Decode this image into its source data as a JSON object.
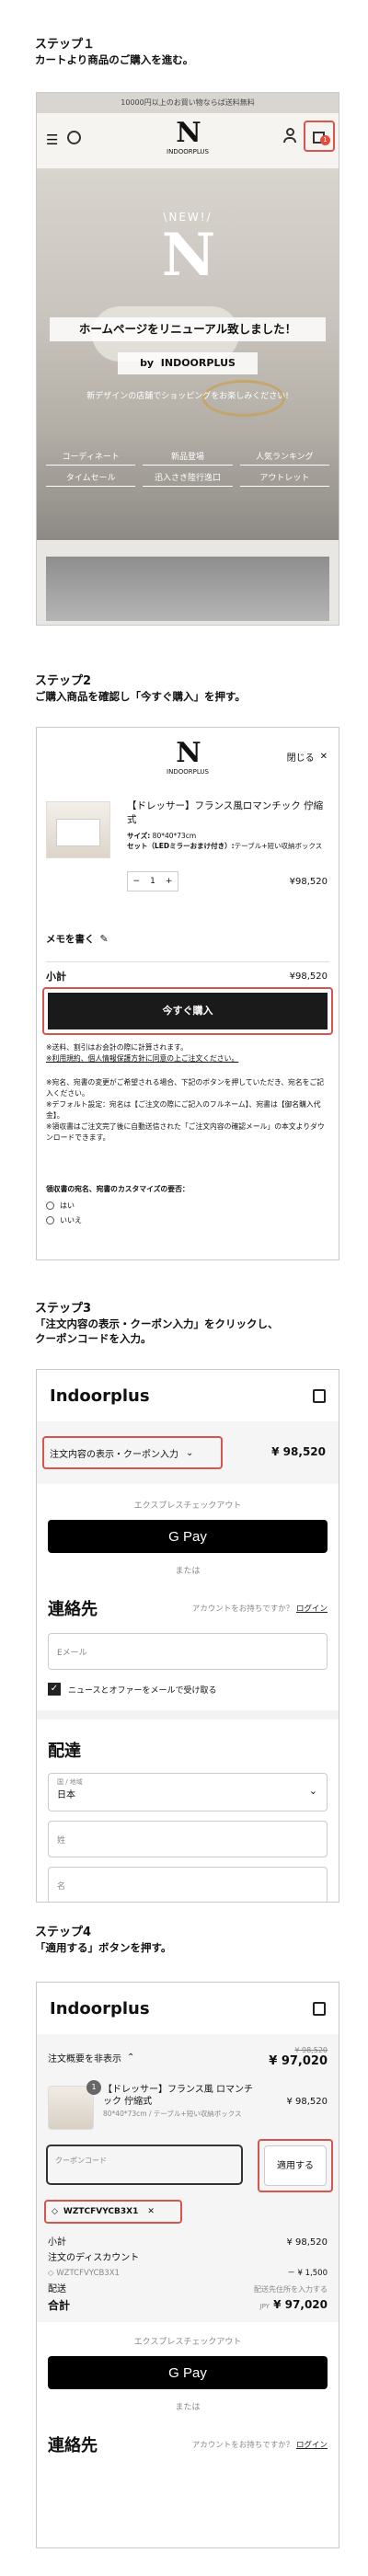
{
  "colors": {
    "accent_red": "#d9534f",
    "dark": "#1a1a1a",
    "banner_bg": "#ededed",
    "hero_overlay": "#000000",
    "badge_red": "#e54b3c"
  },
  "step1": {
    "title": "ステップ１",
    "desc": "カートより商品のご購入を進む。",
    "banner": "10000円以上のお買い物ならば送料無料",
    "brand": "INDOORPLUS",
    "cart_count": "1",
    "new_label": "\\NEW!/",
    "renewal": "ホームページをリニューアル致しました！",
    "by": "by",
    "by_brand": "INDOORPLUS",
    "new_sub": "新デザインの店舗でショッピングをお楽しみください!",
    "nav": [
      "コーディネート",
      "新品登場",
      "人気ランキング",
      "タイムセール",
      "迅入さき陸行逸口",
      "アウトレット"
    ]
  },
  "step2": {
    "title": "ステップ2",
    "desc": "ご購入商品を確認し「今すぐ購入」を押す。",
    "brand": "INDOORPLUS",
    "close": "閉じる",
    "close_x": "✕",
    "product_name": "【ドレッサー】フランス風ロマンチック 佇縮式",
    "size_label": "サイズ:",
    "size_value": "80*40*73cm",
    "set_label": "セット（LEDミラーおまけ付き）:",
    "set_value": "テーブル+短い収納ボックス",
    "qty": "1",
    "qty_minus": "−",
    "qty_plus": "+",
    "price": "¥98,520",
    "memo": "メモを書く",
    "subtotal_label": "小計",
    "subtotal": "¥98,520",
    "buy_now": "今すぐ購入",
    "notes": [
      "※送料、割引はお会計の際に計算されます。",
      "※利用規約、個人情報保護方針に同意の上ご注文ください。",
      "※宛名、宛書の変更がご希望される場合、下記のボタンを押していただき、宛名をご記入ください。",
      "※デフォルト設定：宛名は【ご注文の際にご記入のフルネーム】、宛書は【御名購入代金】。",
      "※領収書はご注文完了後に自動送信された「ご注文内容の確認メール」の本文よりダウンロードできます。"
    ],
    "custom_label": "領収書の宛名、宛書のカスタマイズの要否：",
    "opt_yes": "はい",
    "opt_no": "いいえ"
  },
  "step3": {
    "title": "ステップ3",
    "desc1": "「注文内容の表示・クーポン入力」をクリックし、",
    "desc2": "クーポンコードを入力。",
    "shop": "Indoorplus",
    "order_summary": "注文内容の表示・クーポン入力",
    "chevron": "⌄",
    "total": "¥ 98,520",
    "express": "エクスプレスチェックアウト",
    "gpay": "G Pay",
    "or": "または",
    "contact": "連絡先",
    "account_q": "アカウントをお持ちですか？",
    "login": "ログイン",
    "email_ph": "Eメール",
    "newsletter": "ニュースとオファーをメールで受け取る",
    "delivery": "配達",
    "country_label": "国 / 地域",
    "country": "日本",
    "last_name": "姓",
    "first_name": "名"
  },
  "step4": {
    "title": "ステップ4",
    "desc": "「適用する」ボタンを押す。",
    "shop": "Indoorplus",
    "order_hide": "注文概要を非表示",
    "chevron_up": "⌃",
    "old_total": "¥ 98,520",
    "new_total": "¥ 97,020",
    "product_name": "【ドレッサー】フランス風 ロマンチック 佇縮式",
    "product_price": "¥ 98,520",
    "product_variant": "80*40*73cm / テーブル+短い収納ボックス",
    "badge": "1",
    "coupon_ph": "クーポンコード",
    "apply": "適用する",
    "coupon_code": "WZTCFVYCB3X1",
    "remove": "✕",
    "subtotal_label": "小計",
    "subtotal": "¥ 98,520",
    "discount_label": "注文のディスカウント",
    "discount_code": "WZTCFVYCB3X1",
    "discount": "－ ¥ 1,500",
    "shipping_label": "配送",
    "shipping_note": "配送先住所を入力する",
    "total_label": "合計",
    "currency": "JPY",
    "total": "¥ 97,020",
    "express": "エクスプレスチェックアウト",
    "gpay": "G Pay",
    "or": "または",
    "contact": "連絡先",
    "account_q": "アカウントをお持ちですか？",
    "login": "ログイン"
  }
}
